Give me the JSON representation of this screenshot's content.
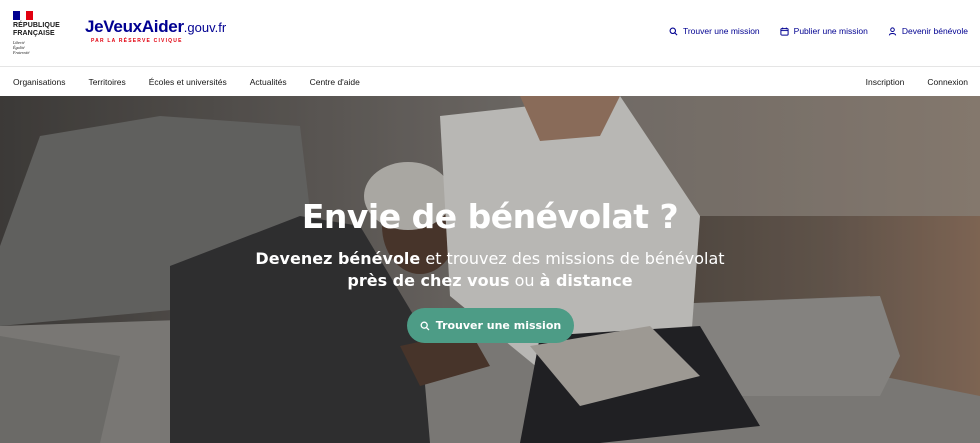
{
  "colors": {
    "flag_blue": "#000091",
    "flag_white": "#ffffff",
    "flag_red": "#e1000f",
    "logo_blue": "#000091",
    "logo_sub_red": "#e1000f",
    "link_blue": "#000091",
    "cta_green": "#4d9c86"
  },
  "gov_block": {
    "title_line1": "RÉPUBLIQUE",
    "title_line2": "FRANÇAISE",
    "motto_line1": "Liberté",
    "motto_line2": "Égalité",
    "motto_line3": "Fraternité"
  },
  "logo": {
    "main": "JeVeuxAider",
    "suffix": ".gouv.fr",
    "subtitle": "PAR LA RÉSERVE CIVIQUE"
  },
  "header_links": [
    {
      "label": "Trouver une mission",
      "icon": "search-icon"
    },
    {
      "label": "Publier une mission",
      "icon": "calendar-icon"
    },
    {
      "label": "Devenir bénévole",
      "icon": "user-icon"
    }
  ],
  "nav": {
    "left": [
      "Organisations",
      "Territoires",
      "Écoles et universités",
      "Actualités",
      "Centre d'aide"
    ],
    "right": [
      "Inscription",
      "Connexion"
    ]
  },
  "hero": {
    "title": "Envie de bénévolat ?",
    "line1_bold": "Devenez bénévole",
    "line1_rest": " et trouvez des missions de bénévolat",
    "line2_bold1": "près de chez vous",
    "line2_mid": " ou ",
    "line2_bold2": "à distance",
    "cta_label": "Trouver une mission",
    "cta_icon": "search-icon"
  }
}
